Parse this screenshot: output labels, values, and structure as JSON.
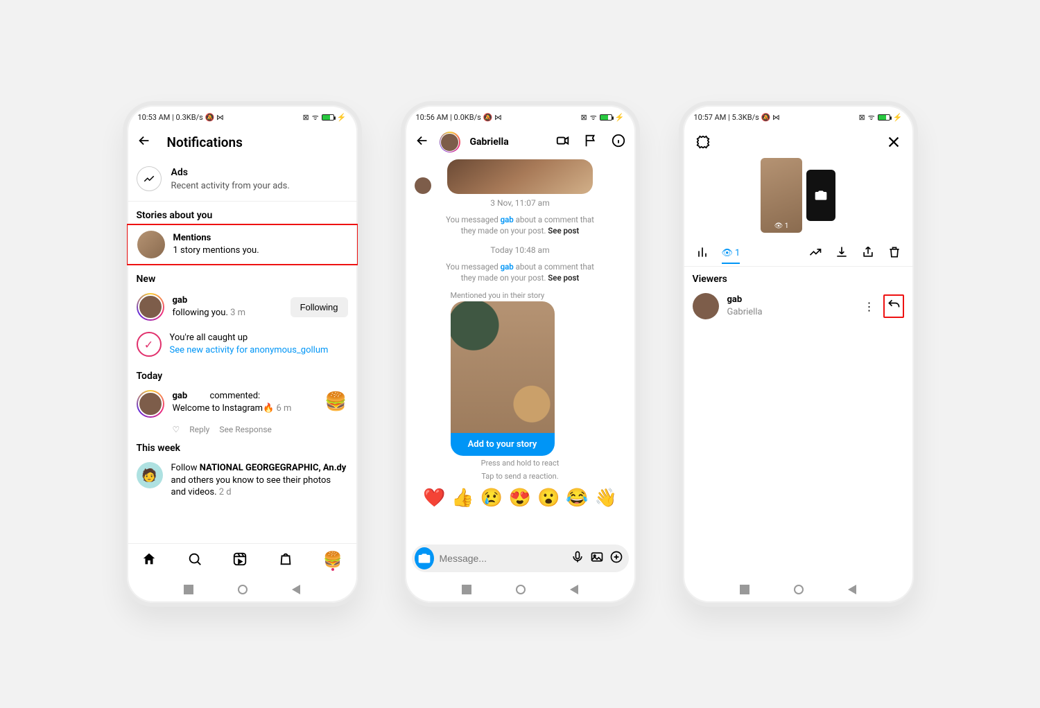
{
  "phone1": {
    "status_left": "10:53 AM | 0.3KB/s 🔕 ⋈",
    "title": "Notifications",
    "ads_title": "Ads",
    "ads_sub": "Recent activity from your ads.",
    "sect_stories": "Stories about you",
    "mentions_title": "Mentions",
    "mentions_sub": "1 story mentions you.",
    "sect_new": "New",
    "follow_user": "gab",
    "follow_text": "following you.",
    "follow_time": "3 m",
    "follow_btn": "Following",
    "caughtup": "You're all caught up",
    "caughtup_link": "See new activity for anonymous_gollum",
    "sect_today": "Today",
    "comment_user": "gab",
    "comment_action": "commented:",
    "comment_body": "Welcome to Instagram🔥",
    "comment_time": "6 m",
    "act_reply": "Reply",
    "act_seeresp": "See Response",
    "sect_week": "This week",
    "week_prefix": "Follow ",
    "week_bold": "NATIONAL GEORGEGRAPHIC, An.dy",
    "week_rest": " and others you know to see their photos and videos.",
    "week_time": "2 d"
  },
  "phone2": {
    "status_left": "10:56 AM | 0.0KB/s 🔕 ⋈",
    "name": "Gabriella",
    "date1": "3 Nov, 11:07 am",
    "sys_pre": "You messaged ",
    "sys_user": "gab",
    "sys_post1": " about a comment that they made on your post. ",
    "sys_seepost": "See post",
    "date2": "Today 10:48 am",
    "mention_caption": "Mentioned you in their story",
    "add_story": "Add to your story",
    "presshold": "Press and hold to react",
    "tapsend": "Tap to send a reaction.",
    "emojis": [
      "❤️",
      "👍",
      "😢",
      "😍",
      "😮",
      "😂",
      "👋"
    ],
    "placeholder": "Message..."
  },
  "phone3": {
    "status_left": "10:57 AM | 5.3KB/s 🔕 ⋈",
    "tab_count": "1",
    "viewers_hdr": "Viewers",
    "viewer_user": "gab",
    "viewer_name": "Gabriella"
  }
}
